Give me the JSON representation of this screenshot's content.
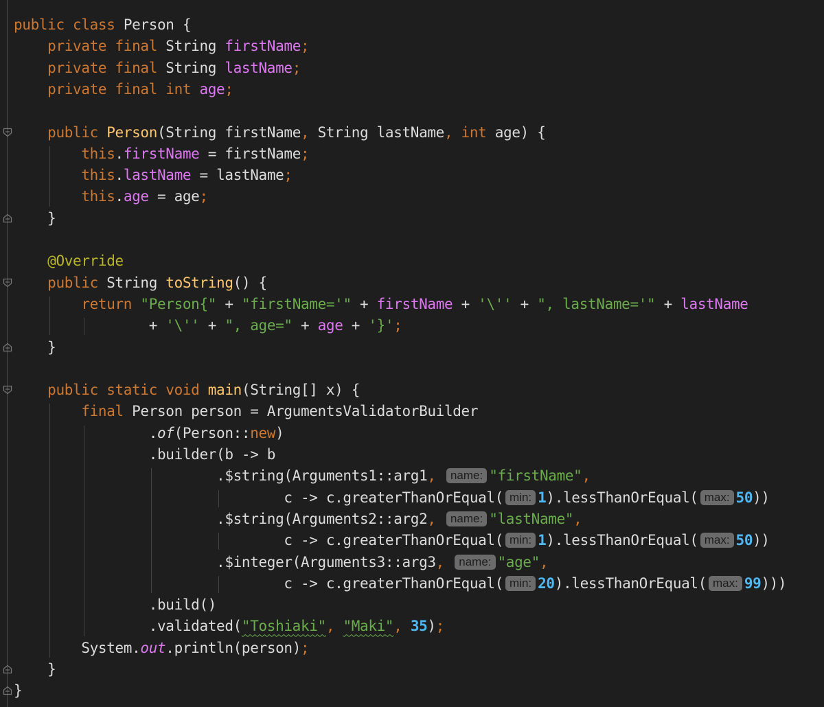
{
  "editor": {
    "language": "Java",
    "colors": {
      "background": "#1e1e1e",
      "keyword": "#cc7832",
      "method": "#ffc66d",
      "field": "#dd77f2",
      "string": "#6aac4c",
      "number": "#4fb8f2",
      "annotation": "#bbb529",
      "hint_bg": "#6b6b6b"
    },
    "lines": [
      [
        {
          "t": "kw",
          "v": "public class "
        },
        {
          "t": "plain",
          "v": "Person {"
        }
      ],
      [
        {
          "t": "kw",
          "v": "    private final "
        },
        {
          "t": "plain",
          "v": "String "
        },
        {
          "t": "field",
          "v": "firstName"
        },
        {
          "t": "kw",
          "v": ";"
        }
      ],
      [
        {
          "t": "kw",
          "v": "    private final "
        },
        {
          "t": "plain",
          "v": "String "
        },
        {
          "t": "field",
          "v": "lastName"
        },
        {
          "t": "kw",
          "v": ";"
        }
      ],
      [
        {
          "t": "kw",
          "v": "    private final int "
        },
        {
          "t": "field",
          "v": "age"
        },
        {
          "t": "kw",
          "v": ";"
        }
      ],
      [
        {
          "t": "plain",
          "v": ""
        }
      ],
      [
        {
          "t": "kw",
          "v": "    public "
        },
        {
          "t": "fn",
          "v": "Person"
        },
        {
          "t": "plain",
          "v": "(String firstName"
        },
        {
          "t": "kw",
          "v": ", "
        },
        {
          "t": "plain",
          "v": "String lastName"
        },
        {
          "t": "kw",
          "v": ", int "
        },
        {
          "t": "plain",
          "v": "age) {"
        }
      ],
      [
        {
          "t": "kw",
          "v": "        this"
        },
        {
          "t": "plain",
          "v": "."
        },
        {
          "t": "field",
          "v": "firstName"
        },
        {
          "t": "plain",
          "v": " = firstName"
        },
        {
          "t": "kw",
          "v": ";"
        }
      ],
      [
        {
          "t": "kw",
          "v": "        this"
        },
        {
          "t": "plain",
          "v": "."
        },
        {
          "t": "field",
          "v": "lastName"
        },
        {
          "t": "plain",
          "v": " = lastName"
        },
        {
          "t": "kw",
          "v": ";"
        }
      ],
      [
        {
          "t": "kw",
          "v": "        this"
        },
        {
          "t": "plain",
          "v": "."
        },
        {
          "t": "field",
          "v": "age"
        },
        {
          "t": "plain",
          "v": " = age"
        },
        {
          "t": "kw",
          "v": ";"
        }
      ],
      [
        {
          "t": "plain",
          "v": "    }"
        }
      ],
      [
        {
          "t": "plain",
          "v": ""
        }
      ],
      [
        {
          "t": "ann",
          "v": "    @Override"
        }
      ],
      [
        {
          "t": "kw",
          "v": "    public "
        },
        {
          "t": "plain",
          "v": "String "
        },
        {
          "t": "fn",
          "v": "toString"
        },
        {
          "t": "plain",
          "v": "() {"
        }
      ],
      [
        {
          "t": "kw",
          "v": "        return "
        },
        {
          "t": "str",
          "v": "\"Person{\""
        },
        {
          "t": "plain",
          "v": " + "
        },
        {
          "t": "str",
          "v": "\"firstName='\""
        },
        {
          "t": "plain",
          "v": " + "
        },
        {
          "t": "field",
          "v": "firstName"
        },
        {
          "t": "plain",
          "v": " + "
        },
        {
          "t": "str",
          "v": "'\\''"
        },
        {
          "t": "plain",
          "v": " + "
        },
        {
          "t": "str",
          "v": "\", lastName='\""
        },
        {
          "t": "plain",
          "v": " + "
        },
        {
          "t": "field",
          "v": "lastName"
        }
      ],
      [
        {
          "t": "plain",
          "v": "                + "
        },
        {
          "t": "str",
          "v": "'\\''"
        },
        {
          "t": "plain",
          "v": " + "
        },
        {
          "t": "str",
          "v": "\", age=\""
        },
        {
          "t": "plain",
          "v": " + "
        },
        {
          "t": "field",
          "v": "age"
        },
        {
          "t": "plain",
          "v": " + "
        },
        {
          "t": "str",
          "v": "'}'"
        },
        {
          "t": "kw",
          "v": ";"
        }
      ],
      [
        {
          "t": "plain",
          "v": "    }"
        }
      ],
      [
        {
          "t": "plain",
          "v": ""
        }
      ],
      [
        {
          "t": "kw",
          "v": "    public static void "
        },
        {
          "t": "fn",
          "v": "main"
        },
        {
          "t": "plain",
          "v": "(String[] x) {"
        }
      ],
      [
        {
          "t": "kw",
          "v": "        final "
        },
        {
          "t": "plain",
          "v": "Person person = ArgumentsValidatorBuilder"
        }
      ],
      [
        {
          "t": "plain",
          "v": "                ."
        },
        {
          "t": "ital",
          "v": "of"
        },
        {
          "t": "plain",
          "v": "(Person::"
        },
        {
          "t": "kw",
          "v": "new"
        },
        {
          "t": "plain",
          "v": ")"
        }
      ],
      [
        {
          "t": "plain",
          "v": "                .builder(b -> b"
        }
      ],
      [
        {
          "t": "plain",
          "v": "                        .$string(Arguments1::arg1"
        },
        {
          "t": "kw",
          "v": ", "
        },
        {
          "t": "hint",
          "v": "name:"
        },
        {
          "t": "str",
          "v": "\"firstName\""
        },
        {
          "t": "kw",
          "v": ","
        }
      ],
      [
        {
          "t": "plain",
          "v": "                                c -> c.greaterThanOrEqual("
        },
        {
          "t": "hint",
          "v": "min:"
        },
        {
          "t": "num",
          "v": "1"
        },
        {
          "t": "plain",
          "v": ").lessThanOrEqual("
        },
        {
          "t": "hint",
          "v": "max:"
        },
        {
          "t": "num",
          "v": "50"
        },
        {
          "t": "plain",
          "v": "))"
        }
      ],
      [
        {
          "t": "plain",
          "v": "                        .$string(Arguments2::arg2"
        },
        {
          "t": "kw",
          "v": ", "
        },
        {
          "t": "hint",
          "v": "name:"
        },
        {
          "t": "str",
          "v": "\"lastName\""
        },
        {
          "t": "kw",
          "v": ","
        }
      ],
      [
        {
          "t": "plain",
          "v": "                                c -> c.greaterThanOrEqual("
        },
        {
          "t": "hint",
          "v": "min:"
        },
        {
          "t": "num",
          "v": "1"
        },
        {
          "t": "plain",
          "v": ").lessThanOrEqual("
        },
        {
          "t": "hint",
          "v": "max:"
        },
        {
          "t": "num",
          "v": "50"
        },
        {
          "t": "plain",
          "v": "))"
        }
      ],
      [
        {
          "t": "plain",
          "v": "                        .$integer(Arguments3::arg3"
        },
        {
          "t": "kw",
          "v": ", "
        },
        {
          "t": "hint",
          "v": "name:"
        },
        {
          "t": "str",
          "v": "\"age\""
        },
        {
          "t": "kw",
          "v": ","
        }
      ],
      [
        {
          "t": "plain",
          "v": "                                c -> c.greaterThanOrEqual("
        },
        {
          "t": "hint",
          "v": "min:"
        },
        {
          "t": "num",
          "v": "20"
        },
        {
          "t": "plain",
          "v": ").lessThanOrEqual("
        },
        {
          "t": "hint",
          "v": "max:"
        },
        {
          "t": "num",
          "v": "99"
        },
        {
          "t": "plain",
          "v": ")))"
        }
      ],
      [
        {
          "t": "plain",
          "v": "                .build()"
        }
      ],
      [
        {
          "t": "plain",
          "v": "                .validated("
        },
        {
          "t": "wavy",
          "v": "\"Toshiaki\""
        },
        {
          "t": "kw",
          "v": ", "
        },
        {
          "t": "wavy",
          "v": "\"Maki\""
        },
        {
          "t": "kw",
          "v": ", "
        },
        {
          "t": "num",
          "v": "35"
        },
        {
          "t": "plain",
          "v": ")"
        },
        {
          "t": "kw",
          "v": ";"
        }
      ],
      [
        {
          "t": "plain",
          "v": "        System."
        },
        {
          "t": "italfield",
          "v": "out"
        },
        {
          "t": "plain",
          "v": ".println(person)"
        },
        {
          "t": "kw",
          "v": ";"
        }
      ],
      [
        {
          "t": "plain",
          "v": "    }"
        }
      ],
      [
        {
          "t": "plain",
          "v": "}"
        }
      ]
    ]
  }
}
